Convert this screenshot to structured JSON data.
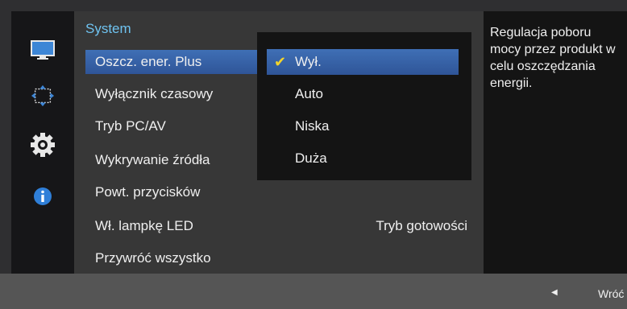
{
  "left_rail": {
    "icons": [
      "monitor-icon",
      "resize-arrows-icon",
      "gear-icon",
      "info-icon"
    ]
  },
  "menu": {
    "title": "System",
    "items": [
      {
        "label": "Oszcz. ener. Plus",
        "selected": true
      },
      {
        "label": "Wyłącznik czasowy"
      },
      {
        "label": "Tryb PC/AV"
      },
      {
        "label": "Wykrywanie źródła"
      },
      {
        "label": "Powt. przycisków"
      },
      {
        "label": "Wł. lampkę LED",
        "value": "Tryb gotowości"
      },
      {
        "label": "Przywróć wszystko"
      }
    ]
  },
  "dropdown": {
    "options": [
      {
        "label": "Wył.",
        "checked": true
      },
      {
        "label": "Auto"
      },
      {
        "label": "Niska"
      },
      {
        "label": "Duża"
      }
    ]
  },
  "help": {
    "text": "Regulacja poboru mocy przez produkt w celu oszczędzania energii."
  },
  "footer": {
    "back_label": "Wróć"
  },
  "colors": {
    "accent": "#3f6fb5",
    "title": "#6fc3f0",
    "check": "#f4d42a"
  }
}
